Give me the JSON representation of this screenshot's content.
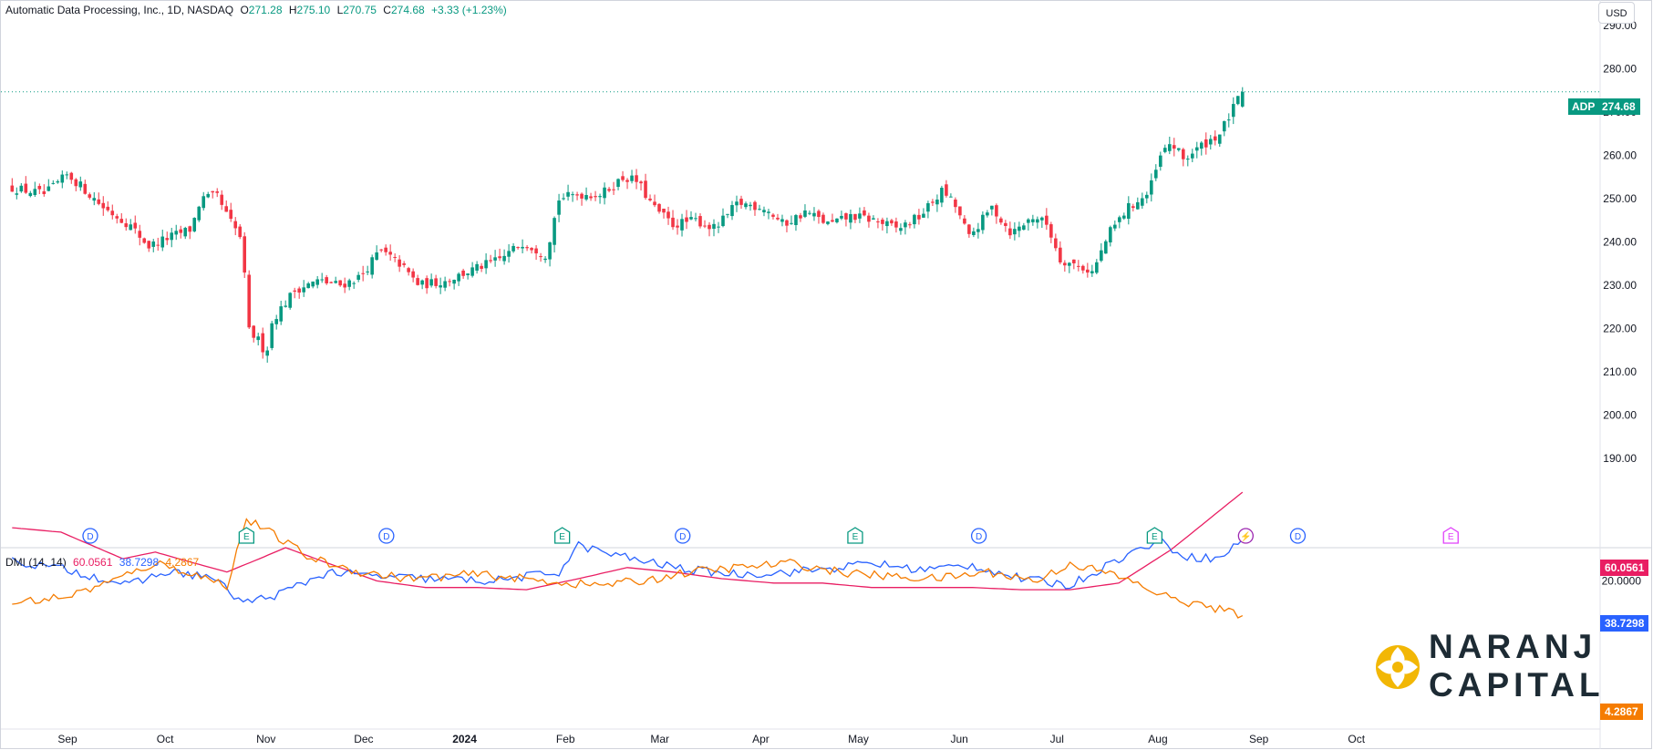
{
  "header": {
    "symbol_name": "Automatic Data Processing, Inc., 1D, NASDAQ",
    "o_label": "O",
    "o_value": "271.28",
    "h_label": "H",
    "h_value": "275.10",
    "l_label": "L",
    "l_value": "270.75",
    "c_label": "C",
    "c_value": "274.68",
    "change": "+3.33 (+1.23%)"
  },
  "currency_button": "USD",
  "price_badge": {
    "ticker": "ADP",
    "price": "274.68"
  },
  "indicator": {
    "label": "DMI (14, 14)",
    "adx": "60.0561",
    "plus_di": "38.7298",
    "minus_di": "4.2867"
  },
  "price_axis_labels": [
    "290.00",
    "280.00",
    "270.00",
    "260.00",
    "250.00",
    "240.00",
    "230.00",
    "220.00",
    "210.00",
    "200.00",
    "190.00"
  ],
  "dmi_axis_labels": [
    "20.0000",
    "0.0000"
  ],
  "time_axis_labels": [
    "Sep",
    "Oct",
    "Nov",
    "Dec",
    "2024",
    "Feb",
    "Mar",
    "Apr",
    "May",
    "Jun",
    "Jul",
    "Aug",
    "Sep",
    "Oct"
  ],
  "event_markers": [
    "D",
    "E",
    "D",
    "E",
    "D",
    "E",
    "D",
    "E",
    "⚡",
    "D",
    "E"
  ],
  "logo": {
    "line1": "NARANJ",
    "line2": "CAPITAL"
  },
  "colors": {
    "up": "#089981",
    "down": "#f23645",
    "adx": "#e91e63",
    "plus_di": "#2962ff",
    "minus_di": "#f57c00",
    "dividend": "#2962ff",
    "earnings": "#089981",
    "split": "#9c27b0",
    "future_earnings": "#e040fb",
    "logo_gold": "#f2b705"
  },
  "chart_data": [
    {
      "type": "candlestick",
      "title": "Automatic Data Processing, Inc., 1D, NASDAQ",
      "ylim": [
        190,
        290
      ],
      "x_ticks": [
        "Sep",
        "Oct",
        "Nov",
        "Dec",
        "2024",
        "Feb",
        "Mar",
        "Apr",
        "May",
        "Jun",
        "Jul",
        "Aug",
        "Sep",
        "Oct"
      ],
      "x_start": "2023-08-15",
      "close_path": [
        [
          "2023-08-15",
          252.5
        ],
        [
          "2023-08-25",
          251
        ],
        [
          "2023-09-01",
          255.5
        ],
        [
          "2023-09-05",
          253
        ],
        [
          "2023-09-12",
          248
        ],
        [
          "2023-09-20",
          244
        ],
        [
          "2023-09-26",
          239
        ],
        [
          "2023-10-02",
          241
        ],
        [
          "2023-10-09",
          243
        ],
        [
          "2023-10-12",
          250
        ],
        [
          "2023-10-17",
          250.5
        ],
        [
          "2023-10-20",
          246
        ],
        [
          "2023-10-25",
          240
        ],
        [
          "2023-10-26",
          220
        ],
        [
          "2023-10-30",
          217
        ],
        [
          "2023-11-01",
          214
        ],
        [
          "2023-11-03",
          222
        ],
        [
          "2023-11-10",
          229
        ],
        [
          "2023-11-17",
          231
        ],
        [
          "2023-11-24",
          230
        ],
        [
          "2023-11-30",
          232
        ],
        [
          "2023-12-06",
          238
        ],
        [
          "2023-12-12",
          235
        ],
        [
          "2023-12-18",
          230
        ],
        [
          "2023-12-26",
          231
        ],
        [
          "2024-01-05",
          234
        ],
        [
          "2024-01-12",
          236
        ],
        [
          "2024-01-19",
          240
        ],
        [
          "2024-01-26",
          237
        ],
        [
          "2024-01-30",
          250
        ],
        [
          "2024-02-05",
          251
        ],
        [
          "2024-02-12",
          251
        ],
        [
          "2024-02-19",
          255
        ],
        [
          "2024-02-23",
          254
        ],
        [
          "2024-02-28",
          248
        ],
        [
          "2024-03-05",
          244
        ],
        [
          "2024-03-12",
          245
        ],
        [
          "2024-03-18",
          243
        ],
        [
          "2024-03-25",
          249
        ],
        [
          "2024-04-02",
          248
        ],
        [
          "2024-04-08",
          244
        ],
        [
          "2024-04-15",
          247
        ],
        [
          "2024-04-22",
          244
        ],
        [
          "2024-04-29",
          246
        ],
        [
          "2024-05-06",
          245
        ],
        [
          "2024-05-13",
          243
        ],
        [
          "2024-05-20",
          246
        ],
        [
          "2024-05-27",
          252
        ],
        [
          "2024-05-31",
          248
        ],
        [
          "2024-06-04",
          241
        ],
        [
          "2024-06-11",
          248
        ],
        [
          "2024-06-17",
          242
        ],
        [
          "2024-06-24",
          246
        ],
        [
          "2024-06-28",
          244
        ],
        [
          "2024-07-02",
          236
        ],
        [
          "2024-07-09",
          234
        ],
        [
          "2024-07-12",
          233
        ],
        [
          "2024-07-17",
          242
        ],
        [
          "2024-07-23",
          248
        ],
        [
          "2024-07-29",
          251
        ],
        [
          "2024-08-02",
          260
        ],
        [
          "2024-08-05",
          263
        ],
        [
          "2024-08-09",
          259
        ],
        [
          "2024-08-14",
          262
        ],
        [
          "2024-08-20",
          265
        ],
        [
          "2024-08-27",
          274.68
        ]
      ],
      "last": {
        "open": 271.28,
        "high": 275.1,
        "low": 270.75,
        "close": 274.68
      }
    },
    {
      "type": "line",
      "title": "DMI (14, 14)",
      "ylim": [
        0,
        60
      ],
      "series": [
        {
          "name": "ADX",
          "color": "#e91e63",
          "points": [
            [
              "2023-08-15",
              44
            ],
            [
              "2023-08-30",
              42
            ],
            [
              "2023-09-18",
              30
            ],
            [
              "2023-09-28",
              33
            ],
            [
              "2023-10-10",
              28
            ],
            [
              "2023-10-20",
              24
            ],
            [
              "2023-10-30",
              30
            ],
            [
              "2023-11-07",
              35
            ],
            [
              "2023-11-20",
              28
            ],
            [
              "2023-12-05",
              20
            ],
            [
              "2023-12-20",
              17
            ],
            [
              "2024-01-05",
              17
            ],
            [
              "2024-01-20",
              16
            ],
            [
              "2024-02-05",
              21
            ],
            [
              "2024-02-20",
              26
            ],
            [
              "2024-03-05",
              24
            ],
            [
              "2024-03-20",
              21
            ],
            [
              "2024-04-05",
              19
            ],
            [
              "2024-04-20",
              19
            ],
            [
              "2024-05-05",
              17
            ],
            [
              "2024-05-20",
              17
            ],
            [
              "2024-06-05",
              17
            ],
            [
              "2024-06-20",
              16
            ],
            [
              "2024-07-05",
              16
            ],
            [
              "2024-07-20",
              19
            ],
            [
              "2024-08-05",
              34
            ],
            [
              "2024-08-27",
              60.0561
            ]
          ]
        },
        {
          "name": "+DI",
          "color": "#2962ff",
          "points": [
            [
              "2023-08-15",
              29
            ],
            [
              "2023-09-01",
              25
            ],
            [
              "2023-09-20",
              18
            ],
            [
              "2023-10-01",
              24
            ],
            [
              "2023-10-15",
              22
            ],
            [
              "2023-10-25",
              10
            ],
            [
              "2023-11-05",
              14
            ],
            [
              "2023-11-20",
              24
            ],
            [
              "2023-12-05",
              22
            ],
            [
              "2023-12-20",
              21
            ],
            [
              "2024-01-10",
              20
            ],
            [
              "2024-01-30",
              24
            ],
            [
              "2024-02-05",
              36
            ],
            [
              "2024-02-15",
              32
            ],
            [
              "2024-02-28",
              28
            ],
            [
              "2024-03-10",
              25
            ],
            [
              "2024-03-25",
              23
            ],
            [
              "2024-04-10",
              24
            ],
            [
              "2024-04-25",
              26
            ],
            [
              "2024-05-05",
              28
            ],
            [
              "2024-05-20",
              25
            ],
            [
              "2024-06-05",
              27
            ],
            [
              "2024-06-20",
              21
            ],
            [
              "2024-07-05",
              18
            ],
            [
              "2024-07-20",
              30
            ],
            [
              "2024-08-01",
              38
            ],
            [
              "2024-08-10",
              31
            ],
            [
              "2024-08-20",
              30
            ],
            [
              "2024-08-27",
              38.7298
            ]
          ]
        },
        {
          "name": "-DI",
          "color": "#f57c00",
          "points": [
            [
              "2023-08-15",
              10
            ],
            [
              "2023-09-01",
              13
            ],
            [
              "2023-09-15",
              20
            ],
            [
              "2023-09-28",
              28
            ],
            [
              "2023-10-08",
              24
            ],
            [
              "2023-10-20",
              18
            ],
            [
              "2023-10-26",
              48
            ],
            [
              "2023-11-02",
              42
            ],
            [
              "2023-11-15",
              30
            ],
            [
              "2023-11-30",
              24
            ],
            [
              "2023-12-15",
              21
            ],
            [
              "2024-01-05",
              23
            ],
            [
              "2024-01-25",
              20
            ],
            [
              "2024-02-10",
              18
            ],
            [
              "2024-02-25",
              20
            ],
            [
              "2024-03-10",
              24
            ],
            [
              "2024-03-25",
              26
            ],
            [
              "2024-04-10",
              28
            ],
            [
              "2024-04-25",
              24
            ],
            [
              "2024-05-10",
              22
            ],
            [
              "2024-05-25",
              21
            ],
            [
              "2024-06-10",
              24
            ],
            [
              "2024-06-25",
              20
            ],
            [
              "2024-07-05",
              28
            ],
            [
              "2024-07-20",
              22
            ],
            [
              "2024-08-05",
              12
            ],
            [
              "2024-08-20",
              7
            ],
            [
              "2024-08-27",
              4.2867
            ]
          ]
        }
      ]
    }
  ]
}
